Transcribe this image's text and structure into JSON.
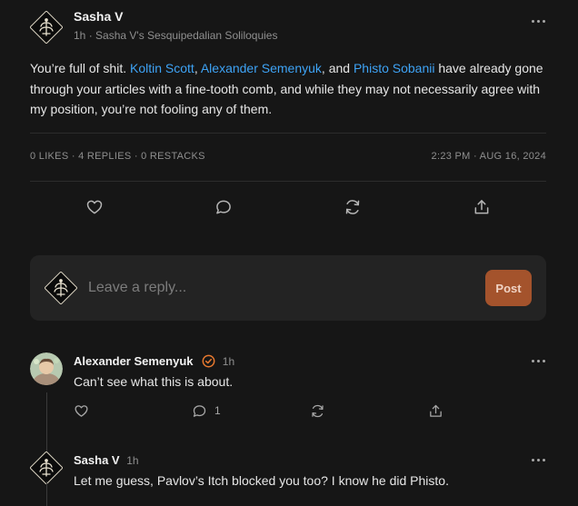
{
  "post": {
    "author": "Sasha V",
    "time": "1h",
    "publication": "Sasha V's Sesquipedalian Soliloquies",
    "body": {
      "part1": "You’re full of shit. ",
      "mention1": "Koltin Scott",
      "sep1": ", ",
      "mention2": "Alexander Semenyuk",
      "sep2": ", and ",
      "mention3": "Phisto Sobanii",
      "part2": " have already gone through your articles with a fine-tooth comb, and while they may not necessarily agree with my position, you’re not fooling any of them."
    },
    "stats": "0 LIKES · 4 REPLIES · 0 RESTACKS",
    "timestamp": "2:23 PM · AUG 16, 2024"
  },
  "reply_box": {
    "placeholder": "Leave a reply...",
    "post_label": "Post"
  },
  "comments": [
    {
      "author": "Alexander Semenyuk",
      "verified": true,
      "time": "1h",
      "text": "Can’t see what this is about.",
      "reply_count": "1"
    },
    {
      "author": "Sasha V",
      "time": "1h",
      "text": "Let me guess, Pavlov’s Itch blocked you too? I know he did Phisto."
    }
  ],
  "colors": {
    "background": "#161616",
    "link": "#3ea3f5",
    "post_button": "#a4532c",
    "verified": "#e8792f"
  },
  "icons": [
    "more-icon",
    "heart-icon",
    "comment-icon",
    "restack-icon",
    "share-icon",
    "verified-icon",
    "logo-avatar"
  ]
}
